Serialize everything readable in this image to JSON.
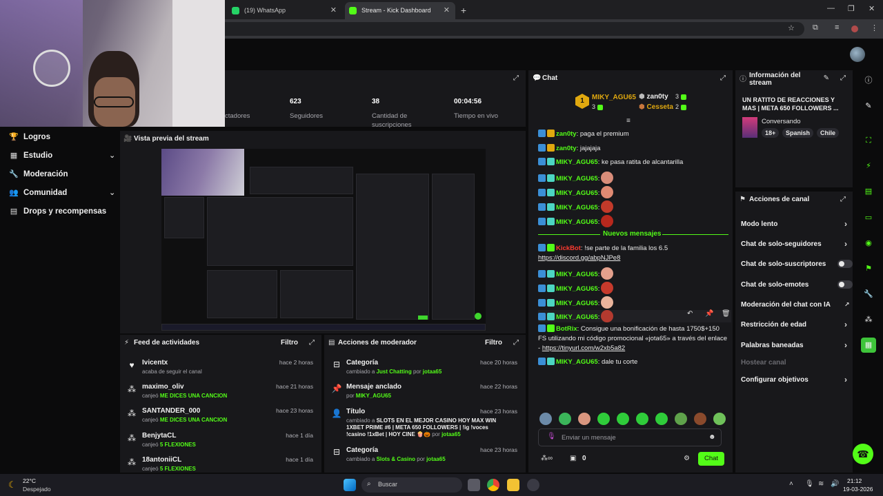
{
  "browser": {
    "tabs": [
      {
        "label": "(19) WhatsApp",
        "active": false
      },
      {
        "label": "Stream - Kick Dashboard",
        "active": true
      }
    ],
    "new_tab": "+"
  },
  "nav": {
    "items": [
      {
        "label": "Logros",
        "icon": "trophy-icon",
        "chevron": false
      },
      {
        "label": "Estudio",
        "icon": "studio-icon",
        "chevron": true
      },
      {
        "label": "Moderación",
        "icon": "wrench-icon",
        "chevron": false
      },
      {
        "label": "Comunidad",
        "icon": "community-icon",
        "chevron": true
      },
      {
        "label": "Drops y recompensas",
        "icon": "drops-icon",
        "chevron": false
      }
    ]
  },
  "stats": [
    {
      "value": "",
      "label": "ctadores"
    },
    {
      "value": "623",
      "label": "Seguidores"
    },
    {
      "value": "38",
      "label": "Cantidad de suscripciones"
    },
    {
      "value": "00:04:56",
      "label": "Tiempo en vivo"
    }
  ],
  "preview": {
    "title": "Vista previa del stream"
  },
  "feed": {
    "title": "Feed de actividades",
    "filter": "Filtro",
    "items": [
      {
        "icon": "heart-icon",
        "name": "Ivicentx",
        "time": "hace 2 horas",
        "sub_text": "acaba de seguir el canal",
        "sub_highlight": ""
      },
      {
        "icon": "points-icon",
        "name": "maximo_oliv",
        "time": "hace 21 horas",
        "sub_text": "canjeó",
        "sub_highlight": "ME DICES UNA CANCION"
      },
      {
        "icon": "points-icon",
        "name": "SANTANDER_000",
        "time": "hace 23 horas",
        "sub_text": "canjeó",
        "sub_highlight": "ME DICES UNA CANCION"
      },
      {
        "icon": "points-icon",
        "name": "BenjytaCL",
        "time": "hace 1 día",
        "sub_text": "canjeó",
        "sub_highlight": "5 FLEXIONES"
      },
      {
        "icon": "points-icon",
        "name": "18antoniiCL",
        "time": "hace 1 día",
        "sub_text": "canjeó",
        "sub_highlight": "5 FLEXIONES"
      }
    ]
  },
  "mod_actions": {
    "title": "Acciones de moderador",
    "filter": "Filtro",
    "items": [
      {
        "icon": "category-icon",
        "title": "Categoría",
        "time": "hace 20 horas",
        "pre": "cambiado a",
        "highlight": "Just Chatting",
        "by": "por",
        "user": "jotaa65"
      },
      {
        "icon": "pin-icon",
        "title": "Mensaje anclado",
        "time": "hace 22 horas",
        "pre": "por",
        "highlight": "",
        "by": "",
        "user": "MIKY_AGU65"
      },
      {
        "icon": "title-icon",
        "title": "Título",
        "time": "hace 23 horas",
        "pre": "cambiado a",
        "highlight": "SLOTS EN EL MEJOR CASINO HOY MAX WIN 1XBET PRIME #6 | META 650 FOLLOWERS | !ig !voces !casino !1xBet | HOY CINE 🍿🎃",
        "by": "por",
        "user": "jotaa65"
      },
      {
        "icon": "category-icon",
        "title": "Categoría",
        "time": "hace 23 horas",
        "pre": "cambiado a",
        "highlight": "Slots & Casino",
        "by": "por",
        "user": "jotaa65"
      }
    ]
  },
  "chat": {
    "title": "Chat",
    "leaderboard": [
      {
        "rank": "1",
        "name": "MIKY_AGU65",
        "count": "3"
      },
      {
        "rank": "",
        "name": "zan0ty",
        "count": "3"
      },
      {
        "rank": "",
        "name": "Cesseta",
        "count": "2"
      }
    ],
    "new_messages": "Nuevos mensajes",
    "messages": [
      {
        "user": "zan0ty",
        "color": "#53fc18",
        "text": ": paga el premium",
        "emotes": 0
      },
      {
        "user": "zan0ty",
        "color": "#53fc18",
        "text": ": jajajaja",
        "emotes": 0
      },
      {
        "user": "MIKY_AGU65",
        "color": "#53fc18",
        "text": ": ke pasa ratita de alcantarilla",
        "emotes": 0
      },
      {
        "user": "MIKY_AGU65",
        "color": "#53fc18",
        "text": ":",
        "emotes": 1
      },
      {
        "user": "MIKY_AGU65",
        "color": "#53fc18",
        "text": ":",
        "emotes": 1
      },
      {
        "user": "MIKY_AGU65",
        "color": "#53fc18",
        "text": ":",
        "emotes": 1
      },
      {
        "user": "MIKY_AGU65",
        "color": "#53fc18",
        "text": ":",
        "emotes": 1
      },
      {
        "user": "KickBot",
        "color": "#ff3b30",
        "text": ": !se parte de la familia los 6.5",
        "link": "https://discord.gg/abpNJPe8",
        "emotes": 0
      },
      {
        "user": "MIKY_AGU65",
        "color": "#53fc18",
        "text": ":",
        "emotes": 1
      },
      {
        "user": "MIKY_AGU65",
        "color": "#53fc18",
        "text": ":",
        "emotes": 1
      },
      {
        "user": "MIKY_AGU65",
        "color": "#53fc18",
        "text": ":",
        "emotes": 1
      },
      {
        "user": "MIKY_AGU65",
        "color": "#53fc18",
        "text": ":",
        "emotes": 1
      },
      {
        "user": "BotRix",
        "color": "#53fc18",
        "text": ": Consigue una bonificación de hasta 1750$+150 FS utilizando mi código promocional «jota65» a través del enlace -",
        "link": "https://tinyurl.com/w2xb5a82",
        "emotes": 0
      },
      {
        "user": "MIKY_AGU65",
        "color": "#53fc18",
        "text": ": dale tu corte",
        "emotes": 0
      }
    ],
    "input_placeholder": "Enviar un mensaje",
    "points": "0",
    "send": "Chat"
  },
  "stream_info": {
    "title": "Información del stream",
    "stream_title": "UN RATITO DE REACCIONES Y MAS | META 650 FOLLOWERS ...",
    "category": "Conversando",
    "tags": [
      "18+",
      "Spanish",
      "Chile"
    ]
  },
  "channel_actions": {
    "title": "Acciones de canal",
    "items": [
      {
        "label": "Modo lento",
        "control": "chevron"
      },
      {
        "label": "Chat de solo-seguidores",
        "control": "chevron"
      },
      {
        "label": "Chat de solo-suscriptores",
        "control": "toggle"
      },
      {
        "label": "Chat de solo-emotes",
        "control": "toggle"
      },
      {
        "label": "Moderación del chat con IA",
        "control": "external"
      },
      {
        "label": "Restricción de edad",
        "control": "chevron"
      },
      {
        "label": "Palabras baneadas",
        "control": "chevron"
      },
      {
        "label": "Hostear canal",
        "control": "none"
      },
      {
        "label": "Configurar objetivos",
        "control": "chevron"
      }
    ]
  },
  "taskbar": {
    "weather_temp": "22°C",
    "weather_desc": "Despejado",
    "search": "Buscar",
    "time": "21:12",
    "date": "19-03-2026"
  },
  "colors": {
    "accent": "#53fc18",
    "bg": "#0b0b0c",
    "panel": "#18181b"
  }
}
